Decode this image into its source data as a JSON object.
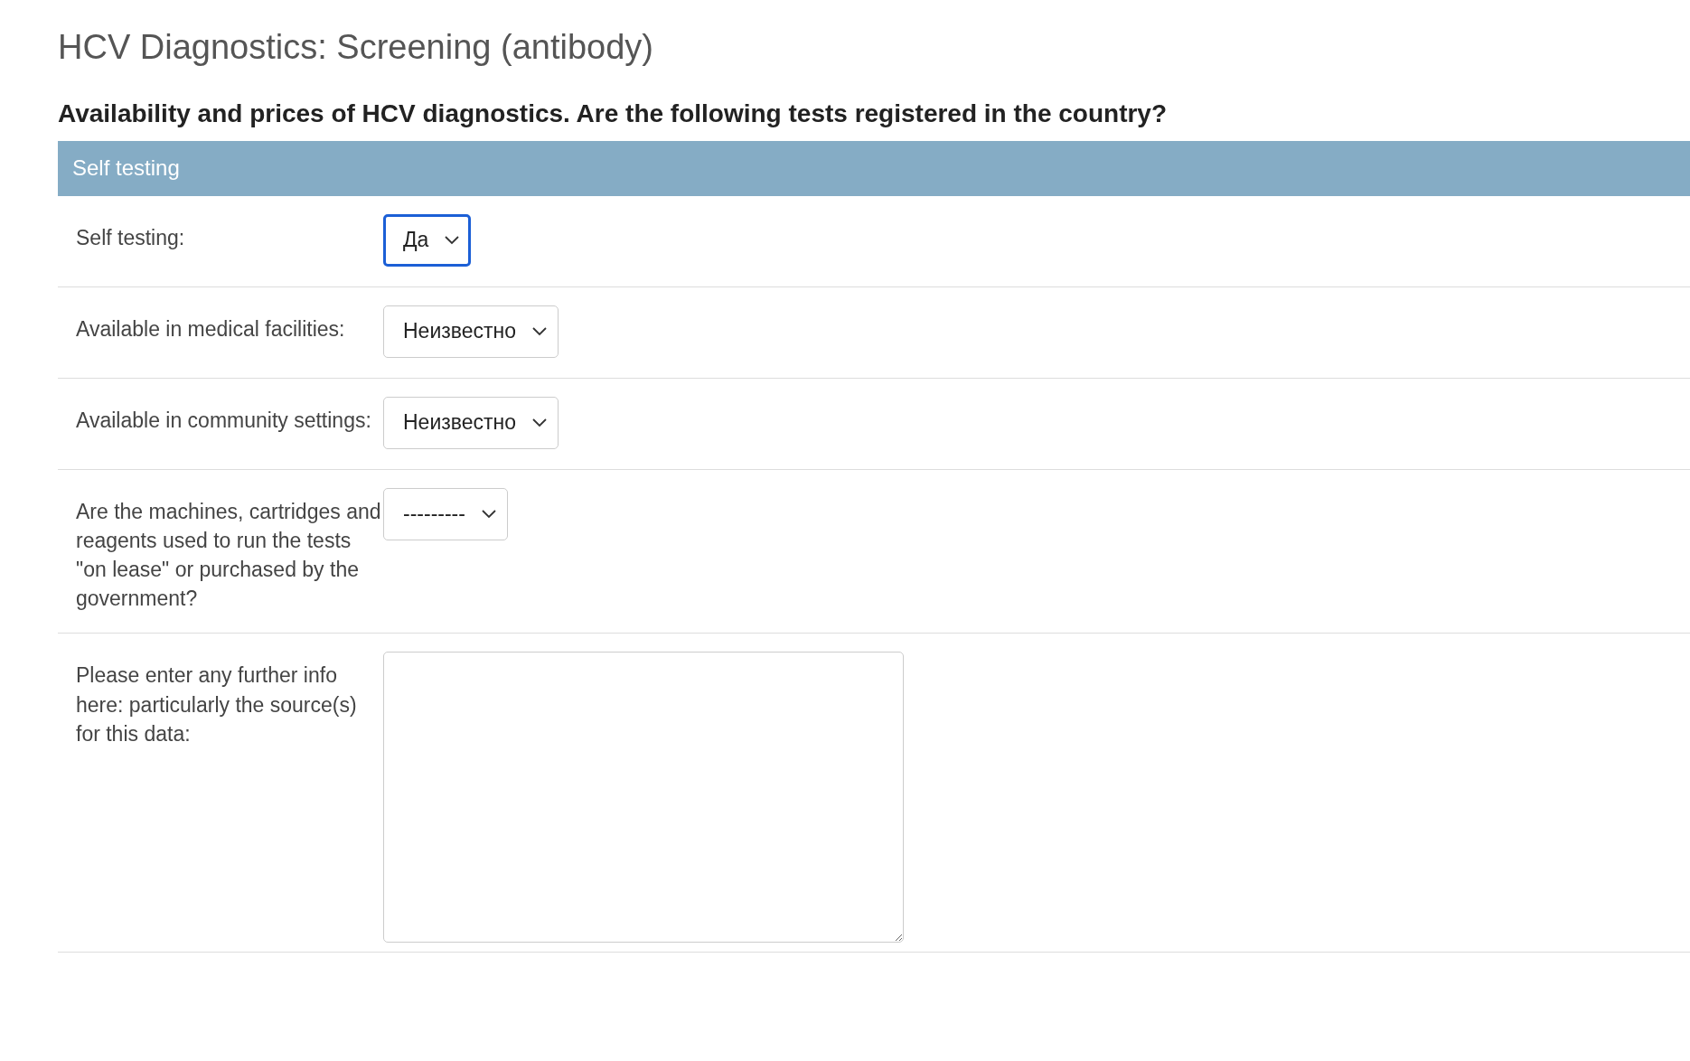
{
  "page_title": "HCV Diagnostics: Screening (antibody)",
  "question": "Availability and prices of HCV diagnostics. Are the following tests registered in the country?",
  "section": {
    "title": "Self testing",
    "fields": [
      {
        "kind": "select",
        "label": "Self testing:",
        "value": "Да",
        "focused": true
      },
      {
        "kind": "select",
        "label": "Available in medical facilities:",
        "value": "Неизвестно",
        "focused": false
      },
      {
        "kind": "select",
        "label": "Available in community settings:",
        "value": "Неизвестно",
        "focused": false
      },
      {
        "kind": "select",
        "label": "Are the machines, cartridges and reagents used to run the tests \"on lease\" or purchased by the government?",
        "value": "---------",
        "focused": false
      },
      {
        "kind": "textarea",
        "label": "Please enter any further info here: particularly the source(s) for this data:"
      }
    ]
  }
}
